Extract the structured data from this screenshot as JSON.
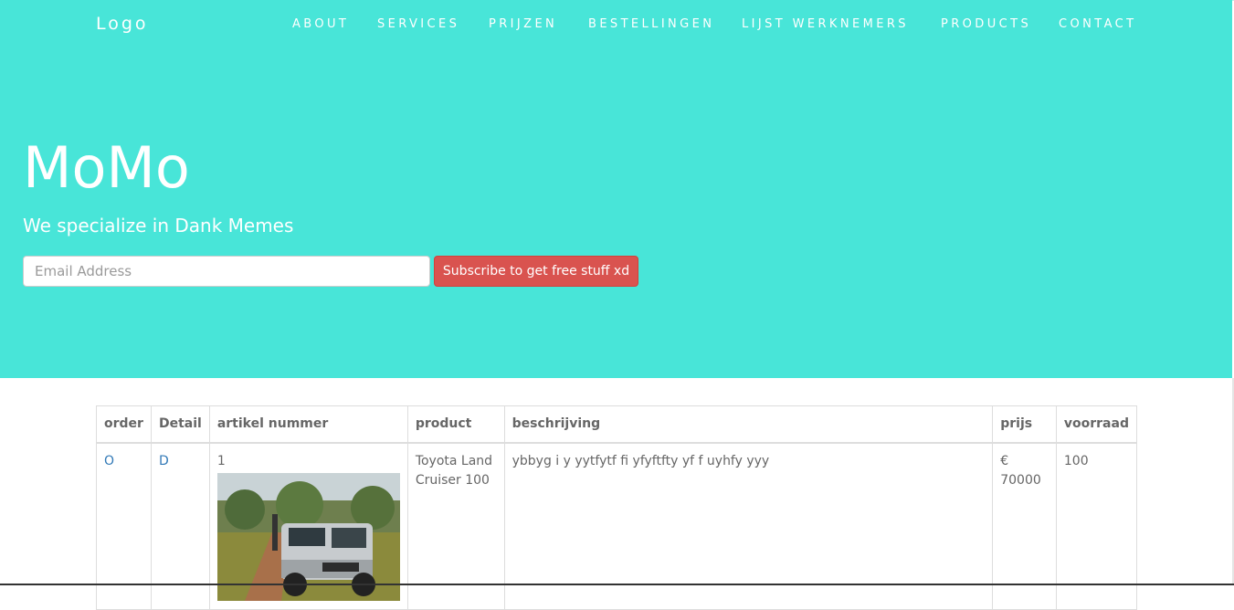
{
  "header": {
    "logo": "Logo",
    "nav": [
      {
        "label": "ABOUT",
        "key": "about"
      },
      {
        "label": "SERVICES",
        "key": "services"
      },
      {
        "label": "PRIJZEN",
        "key": "prijzen"
      },
      {
        "label": "BESTELLINGEN",
        "key": "bestellingen"
      },
      {
        "label": "LIJST WERKNEMERS",
        "key": "lijst-werknemers"
      },
      {
        "label": "PRODUCTS",
        "key": "products"
      },
      {
        "label": "CONTACT",
        "key": "contact"
      }
    ]
  },
  "hero": {
    "title": "MoMo",
    "subtitle": "We specialize in Dank Memes",
    "email_placeholder": "Email Address",
    "subscribe_label": "Subscribe to get free stuff xd"
  },
  "table": {
    "headers": [
      "order",
      "Detail",
      "artikel nummer",
      "product",
      "beschrijving",
      "prijs",
      "voorraad"
    ],
    "rows": [
      {
        "order": "O",
        "detail": "D",
        "artikel_nummer": "1",
        "product": "Toyota Land Cruiser 100",
        "beschrijving": "ybbyg i y yytfytf fi yfyftfty yf f uyhfy yyy",
        "prijs": "€ 70000",
        "voorraad": "100"
      }
    ]
  },
  "colors": {
    "hero_bg": "#48e5d8",
    "subscribe_bg": "#d9534f",
    "link": "#337ab7"
  }
}
